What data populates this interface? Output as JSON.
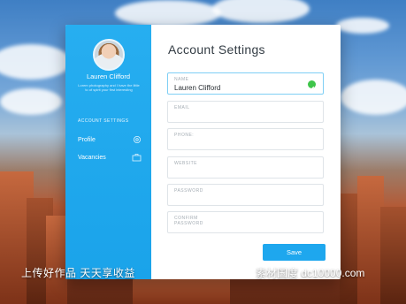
{
  "sidebar": {
    "user_name": "Lauren Clifford",
    "user_bio": "Lorem photography and I have the little to of spirit your first interesting",
    "section_heading": "ACCOUNT SETTINGS",
    "items": [
      {
        "label": "Profile",
        "icon": "gear-icon"
      },
      {
        "label": "Vacancies",
        "icon": "briefcase-icon"
      }
    ]
  },
  "main": {
    "title": "Account Settings",
    "fields": [
      {
        "label": "NAME",
        "value": "Lauren Clifford",
        "valid": true
      },
      {
        "label": "EMAIL",
        "value": ""
      },
      {
        "label": "PHONE:",
        "value": ""
      },
      {
        "label": "WEBSITE",
        "value": ""
      },
      {
        "label": "PASSWORD",
        "value": ""
      },
      {
        "label": "CONFIRM\nPASSWORD",
        "value": ""
      }
    ],
    "save_label": "Save"
  },
  "watermark": {
    "left": "上传好作品 天天享收益",
    "right": "素材国度 dc10000.com"
  },
  "colors": {
    "accent": "#1ea7ee",
    "sidebar": "#27aef0",
    "valid": "#3ec54a"
  }
}
